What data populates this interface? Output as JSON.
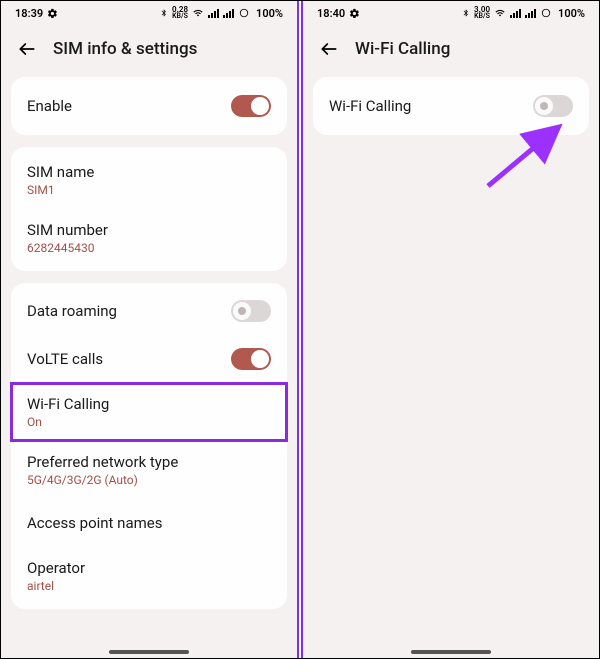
{
  "left": {
    "status": {
      "time": "18:39",
      "net_speed": "0.28",
      "net_unit": "KB/S",
      "battery": "100%"
    },
    "header": {
      "title": "SIM info & settings"
    },
    "card1": {
      "enable_label": "Enable"
    },
    "card2": {
      "simname_label": "SIM name",
      "simname_value": "SIM1",
      "simnumber_label": "SIM number",
      "simnumber_value": "6282445430"
    },
    "card3": {
      "roaming_label": "Data roaming",
      "volte_label": "VoLTE calls",
      "wificalling_label": "Wi-Fi Calling",
      "wificalling_value": "On",
      "preferred_label": "Preferred network type",
      "preferred_value": "5G/4G/3G/2G (Auto)",
      "apn_label": "Access point names",
      "operator_label": "Operator",
      "operator_value": "airtel"
    }
  },
  "right": {
    "status": {
      "time": "18:40",
      "net_speed": "3.00",
      "net_unit": "KB/S",
      "battery": "100%"
    },
    "header": {
      "title": "Wi-Fi Calling"
    },
    "card1": {
      "wificalling_label": "Wi-Fi Calling"
    }
  }
}
